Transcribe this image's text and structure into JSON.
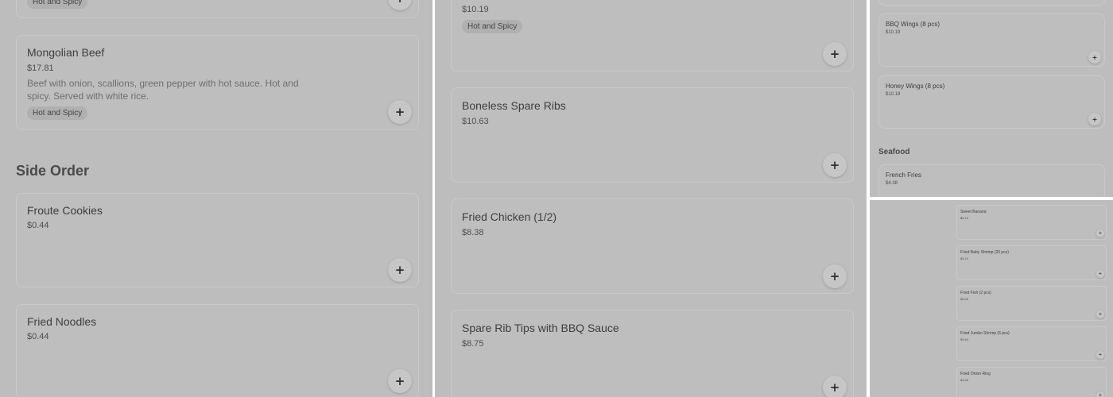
{
  "panel1": {
    "top_item": {
      "tag": "Hot and Spicy"
    },
    "mongolian_beef": {
      "name": "Mongolian Beef",
      "price": "$17.81",
      "description": "Beef with onion, scallions, green pepper with hot sauce. Hot and spicy. Served with white rice.",
      "tag": "Hot and Spicy"
    },
    "section_title": "Side Order",
    "froute_cookies": {
      "name": "Froute Cookies",
      "price": "$0.44"
    },
    "fried_noodles": {
      "name": "Fried Noodles",
      "price": "$0.44"
    }
  },
  "panel2": {
    "top_item": {
      "price": "$10.19",
      "tag": "Hot and Spicy"
    },
    "boneless_spare_ribs": {
      "name": "Boneless Spare Ribs",
      "price": "$10.63"
    },
    "fried_chicken": {
      "name": "Fried Chicken (1/2)",
      "price": "$8.38"
    },
    "spare_rib_tips": {
      "name": "Spare Rib Tips with BBQ Sauce",
      "price": "$8.75"
    }
  },
  "panel3": {
    "bbq_wings": {
      "name": "BBQ Wings (8 pcs)",
      "price": "$10.19"
    },
    "honey_wings": {
      "name": "Honey Wings (8 pcs)",
      "price": "$10.19"
    },
    "section_title": "Seafood",
    "french_fries": {
      "name": "French Fries",
      "price": "$4.38"
    }
  },
  "panel4": {
    "items": [
      {
        "name": "Sweet Banana",
        "price": "$5.19"
      },
      {
        "name": "Fried Baby Shrimp (20 pcs)",
        "price": "$9.19"
      },
      {
        "name": "Fried Fish (2 pcs)",
        "price": "$8.06"
      },
      {
        "name": "Fried Jumbo Shrimp (6 pcs)",
        "price": "$9.84"
      },
      {
        "name": "Fried Onion Ring",
        "price": "$4.06"
      }
    ]
  },
  "add_label": "+",
  "colors": {
    "overlay": "#bdbdbd",
    "card": "#bebebe",
    "tag": "#b0b0b0",
    "text": "#3e3e3e"
  }
}
